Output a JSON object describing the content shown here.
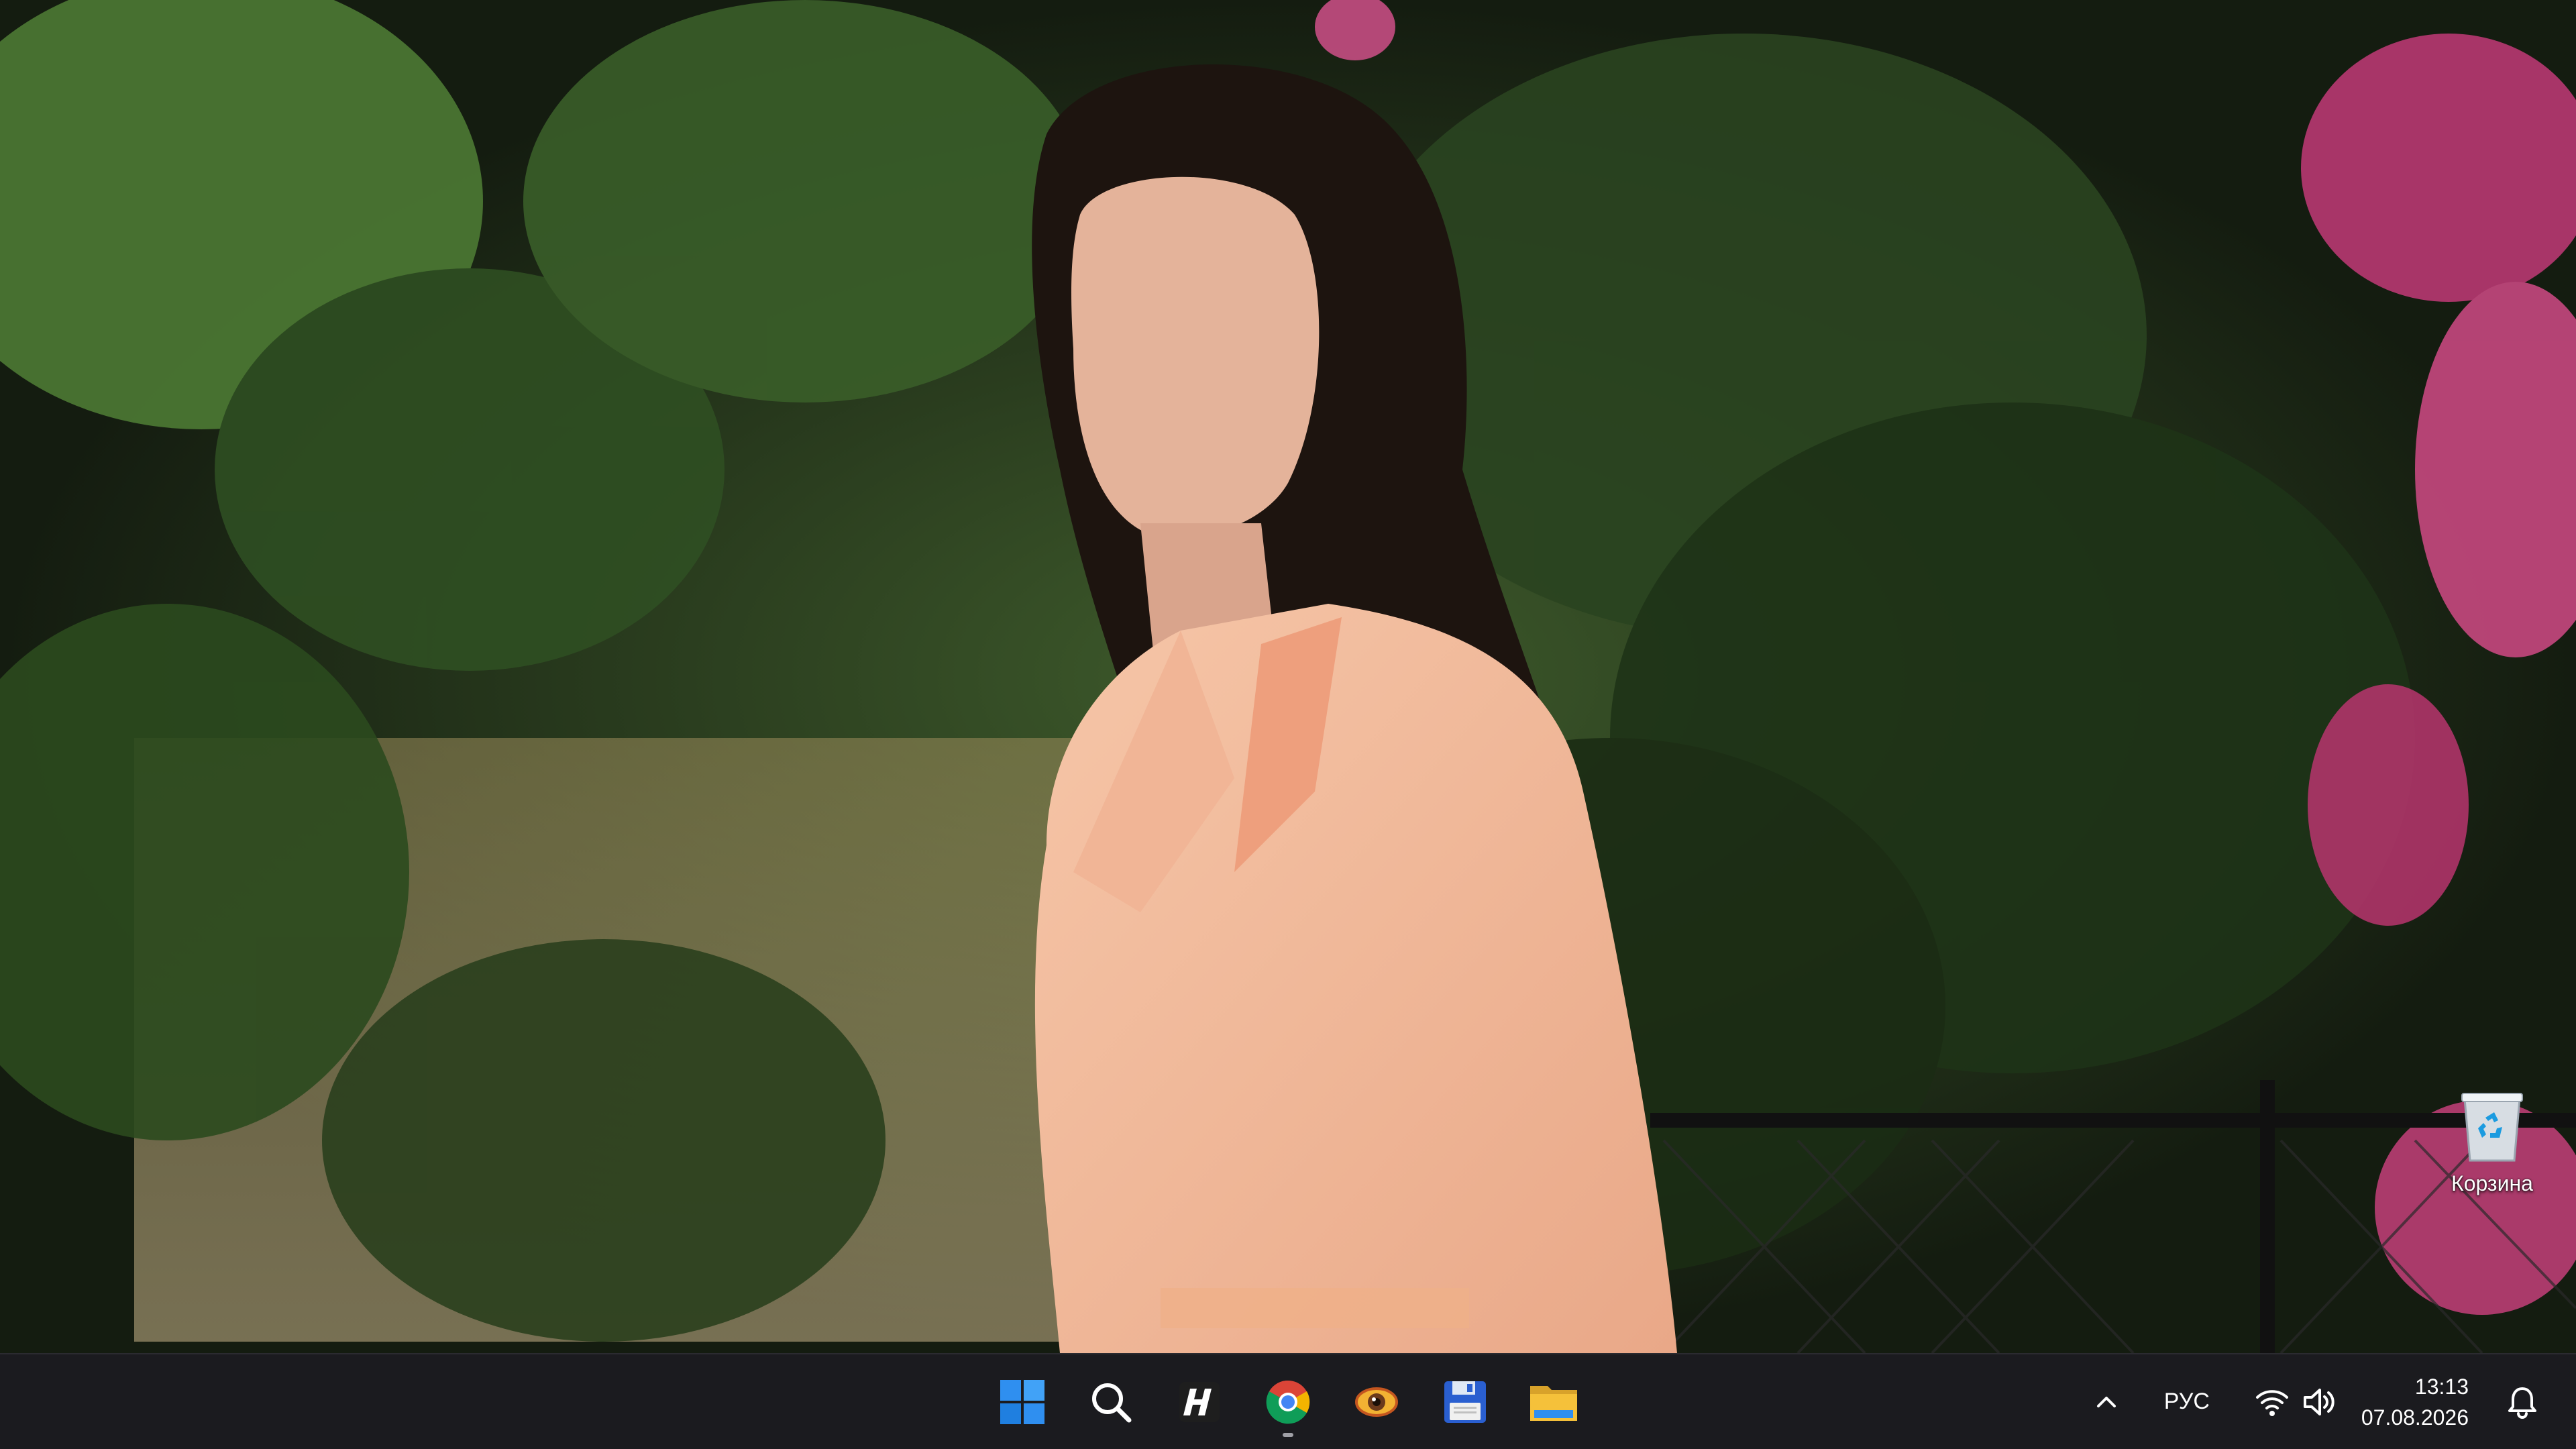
{
  "desktop": {
    "icons": [
      {
        "label": "Корзина",
        "icon": "recycle-bin-icon"
      }
    ]
  },
  "taskbar": {
    "apps": [
      {
        "icon": "windows-start-icon",
        "running": false
      },
      {
        "icon": "search-icon",
        "running": false
      },
      {
        "icon": "h-app-icon",
        "running": false
      },
      {
        "icon": "chrome-icon",
        "running": true
      },
      {
        "icon": "eye-app-icon",
        "running": false
      },
      {
        "icon": "floppy-disk-icon",
        "running": false
      },
      {
        "icon": "file-explorer-icon",
        "running": false
      }
    ],
    "tray": {
      "language": "РУС",
      "time": "13:13",
      "date": "07.08.2026"
    }
  },
  "colors": {
    "taskbar_bg": "#1b1b1f",
    "start_blue": "#2f8ff0",
    "explorer_yellow": "#f5c13a"
  }
}
